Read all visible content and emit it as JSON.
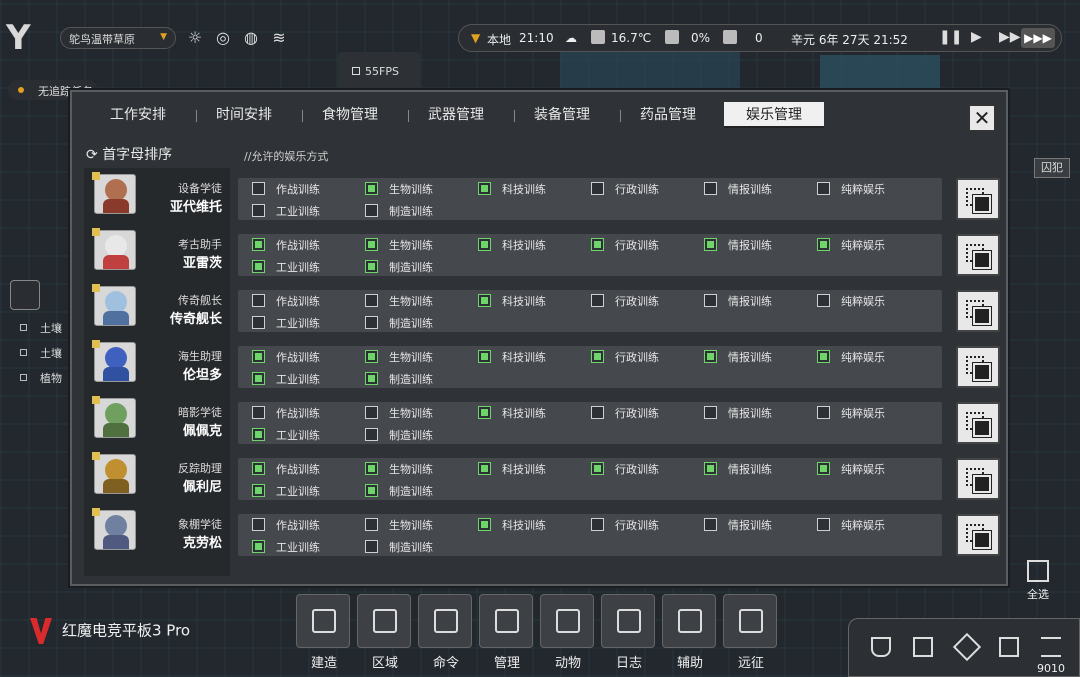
{
  "top_left": {
    "logo": "Y",
    "region": "鸵鸟温带草原",
    "fps": "55FPS",
    "quest": "无追踪任务"
  },
  "status_bar": {
    "location": "本地",
    "local_time": "21:10",
    "temperature": "16.7℃",
    "percent": "0%",
    "count": "0",
    "date": "辛元 6年 27天 21:52"
  },
  "dialog": {
    "tabs": [
      {
        "label": "工作安排",
        "active": false
      },
      {
        "label": "时间安排",
        "active": false
      },
      {
        "label": "食物管理",
        "active": false
      },
      {
        "label": "武器管理",
        "active": false
      },
      {
        "label": "装备管理",
        "active": false
      },
      {
        "label": "药品管理",
        "active": false
      },
      {
        "label": "娱乐管理",
        "active": true
      }
    ],
    "sort_label": "首字母排序",
    "hint": "//允许的娱乐方式",
    "option_labels": [
      "作战训练",
      "生物训练",
      "科技训练",
      "行政训练",
      "情报训练",
      "纯粹娱乐",
      "工业训练",
      "制造训练"
    ],
    "characters": [
      {
        "title": "设备学徒",
        "name": "亚代维托",
        "head": "#b07050",
        "body": "#8a3a2a",
        "checks": [
          false,
          true,
          true,
          false,
          false,
          false,
          false,
          false
        ]
      },
      {
        "title": "考古助手",
        "name": "亚雷茨",
        "head": "#e8e8e8",
        "body": "#c04040",
        "checks": [
          true,
          true,
          true,
          true,
          true,
          true,
          true,
          true
        ]
      },
      {
        "title": "传奇舰长",
        "name": "传奇舰长",
        "head": "#a0c0e0",
        "body": "#5070a0",
        "checks": [
          false,
          false,
          true,
          false,
          false,
          false,
          false,
          false
        ]
      },
      {
        "title": "海生助理",
        "name": "伦坦多",
        "head": "#4060c0",
        "body": "#3050a0",
        "checks": [
          true,
          true,
          true,
          true,
          true,
          true,
          true,
          true
        ]
      },
      {
        "title": "暗影学徒",
        "name": "佩佩克",
        "head": "#70a060",
        "body": "#507040",
        "checks": [
          false,
          false,
          true,
          false,
          false,
          false,
          true,
          false
        ]
      },
      {
        "title": "反踪助理",
        "name": "佩利尼",
        "head": "#c09030",
        "body": "#806020",
        "checks": [
          true,
          true,
          true,
          true,
          true,
          true,
          true,
          true
        ]
      },
      {
        "title": "象棚学徒",
        "name": "克劳松",
        "head": "#7080a0",
        "body": "#505a80",
        "checks": [
          false,
          false,
          true,
          false,
          false,
          false,
          true,
          false
        ]
      }
    ]
  },
  "side": {
    "items": [
      "土壤",
      "土壤",
      "植物"
    ],
    "prisoner": "囚犯"
  },
  "toolbar": [
    {
      "label": "建造"
    },
    {
      "label": "区域"
    },
    {
      "label": "命令"
    },
    {
      "label": "管理"
    },
    {
      "label": "动物"
    },
    {
      "label": "日志"
    },
    {
      "label": "辅助"
    },
    {
      "label": "远征"
    }
  ],
  "select_all": "全选",
  "brand": "红魔电竞平板3 Pro",
  "bottom_right": {
    "number": "9010"
  }
}
